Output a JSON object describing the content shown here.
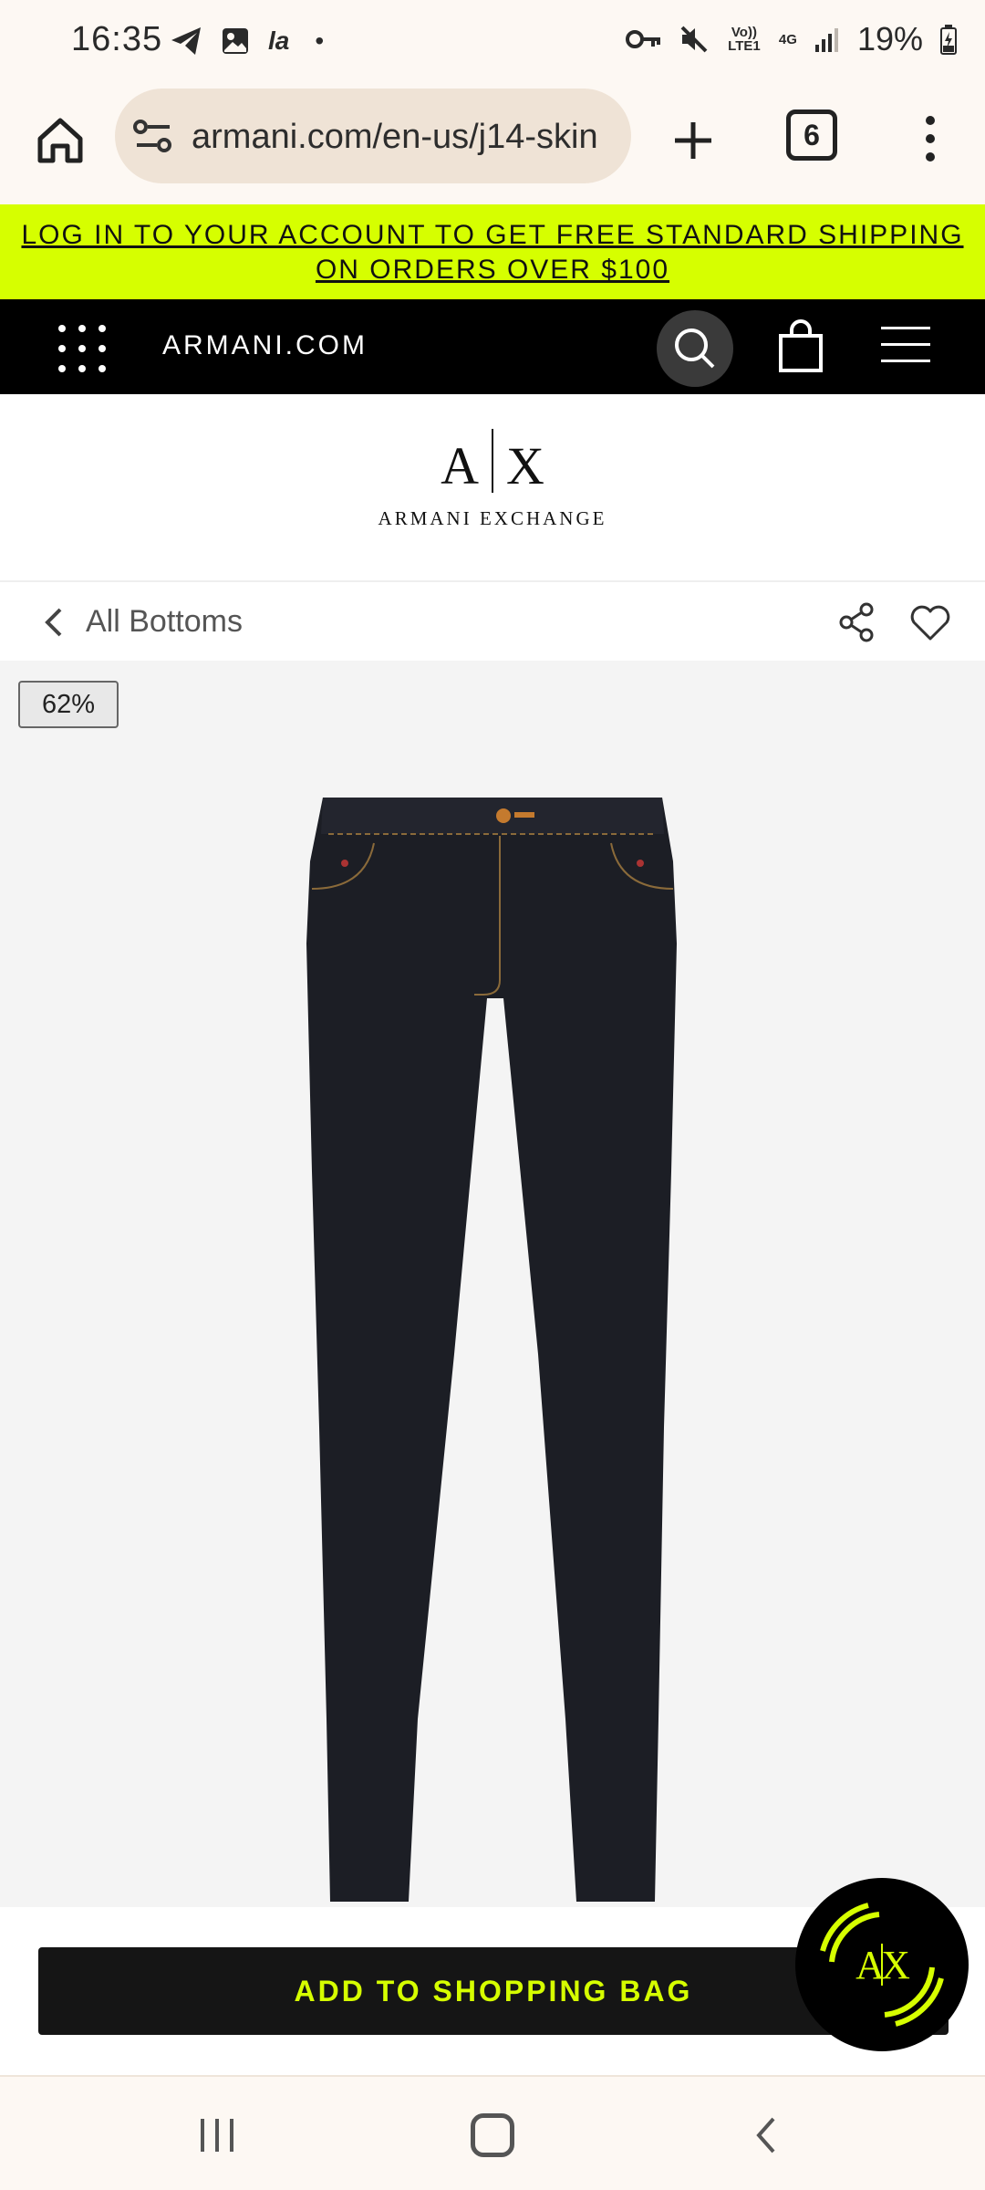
{
  "status_bar": {
    "time": "16:35",
    "carrier_glyph": "la",
    "notification_dot": "•",
    "network_label": "Vo)) LTE1",
    "network_type": "4G",
    "battery": "19%"
  },
  "browser": {
    "url": "armani.com/en-us/j14-skin",
    "tab_count": "6"
  },
  "promo_banner": {
    "text": "LOG IN TO YOUR ACCOUNT TO GET FREE STANDARD SHIPPING ON ORDERS OVER $100"
  },
  "site_nav": {
    "site_name": "ARMANI.COM"
  },
  "brand": {
    "logo_mark_left": "A",
    "logo_mark_right": "X",
    "logo_text": "ARMANI EXCHANGE"
  },
  "breadcrumb": {
    "label": "All Bottoms"
  },
  "product": {
    "zoom_badge": "62%",
    "image_icon": "jeans-image"
  },
  "cta": {
    "add_to_bag_label": "ADD TO SHOPPING BAG"
  },
  "chat_widget": {
    "label_left": "A",
    "label_right": "X"
  },
  "colors": {
    "accent_lime": "#d6ff00",
    "nav_black": "#000000",
    "browser_bg": "#fdf8f3",
    "url_pill": "#efe3d6"
  }
}
